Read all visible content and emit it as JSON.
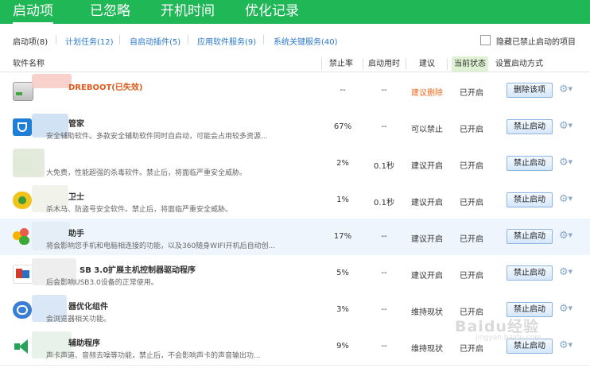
{
  "tabs": {
    "startup": "启动项",
    "ignored": "已忽略",
    "boot_time": "开机时间",
    "optimize_log": "优化记录"
  },
  "filters": {
    "startup_items": "启动项(8)",
    "scheduled_tasks": "计划任务(12)",
    "startup_plugins": "自启动插件(5)",
    "app_services": "应用软件服务(9)",
    "system_services": "系统关键服务(40)",
    "hide_label": "隐藏已禁止启动的项目"
  },
  "columns": {
    "software": "软件名称",
    "ban_rate": "禁止率",
    "startup_time": "启动用时",
    "suggestion": "建议",
    "current_state": "当前状态",
    "set_mode": "设置启动方式"
  },
  "rows": [
    {
      "name": "DREBOOT(已失效)",
      "desc": "",
      "rate": "--",
      "time": "--",
      "suggestion": "建议删除",
      "state": "已开启",
      "action": "删除该项"
    },
    {
      "name": "管家",
      "desc": "安全辅助软件。多款安全辅助软件同时自启动，可能会占用较多资源...",
      "rate": "67%",
      "time": "--",
      "suggestion": "可以禁止",
      "state": "已开启",
      "action": "禁止启动"
    },
    {
      "name": "",
      "desc": "大免费，性能超强的杀毒软件。禁止后，将面临严重安全威胁。",
      "rate": "2%",
      "time": "0.1秒",
      "suggestion": "建议开启",
      "state": "已开启",
      "action": "禁止启动"
    },
    {
      "name": "卫士",
      "desc": "杀木马、防盗号安全软件。禁止后，将面临严重安全威胁。",
      "rate": "1%",
      "time": "0.1秒",
      "suggestion": "建议开启",
      "state": "已开启",
      "action": "禁止启动"
    },
    {
      "name": "助手",
      "desc": "将会影响您手机和电脑相连接的功能，以及360随身WIFI开机后自动创...",
      "rate": "17%",
      "time": "--",
      "suggestion": "建议开启",
      "state": "已开启",
      "action": "禁止启动"
    },
    {
      "name": "SB 3.0扩展主机控制器驱动程序",
      "desc": "后会影响USB3.0设备的正常使用。",
      "rate": "5%",
      "time": "--",
      "suggestion": "建议开启",
      "state": "已开启",
      "action": "禁止启动"
    },
    {
      "name": "器优化组件",
      "desc": "会浏览器相关功能。",
      "rate": "3%",
      "time": "--",
      "suggestion": "维持现状",
      "state": "已开启",
      "action": "禁止启动"
    },
    {
      "name": "辅助程序",
      "desc": "声卡声道、音频去噪等功能，禁止后，不会影响声卡的声音输出功...",
      "rate": "9%",
      "time": "--",
      "suggestion": "维持现状",
      "state": "已开启",
      "action": "禁止启动"
    }
  ],
  "watermark": {
    "brand": "Baidu经验",
    "url": "jingyan.baidu.com"
  },
  "colors": {
    "brand_green": "#20b756",
    "link_blue": "#2a79c9",
    "warn_orange": "#e86a1c"
  }
}
